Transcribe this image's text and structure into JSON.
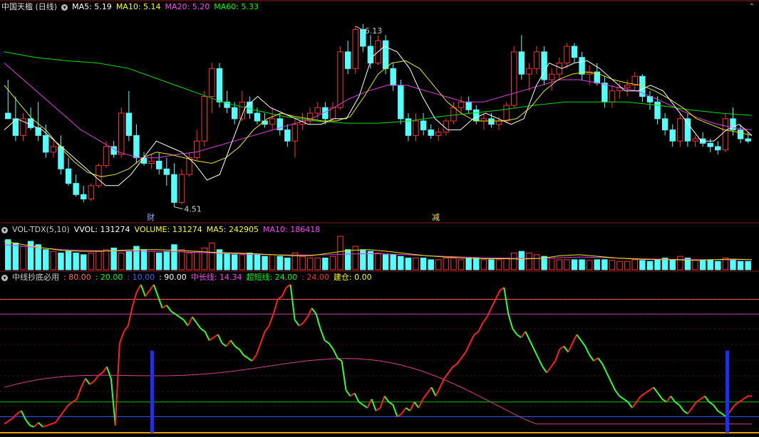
{
  "price_panel": {
    "title": "中国天楹 (日线)",
    "ma_labels": [
      {
        "text": "MA5: 5.19",
        "color": "#ffffff"
      },
      {
        "text": "MA10: 5.14",
        "color": "#ffff00"
      },
      {
        "text": "MA20: 5.20",
        "color": "#ff44ff"
      },
      {
        "text": "MA60: 5.33",
        "color": "#00ff00"
      }
    ],
    "high_label": "6.13",
    "low_label": "4.51",
    "marker_cai": "财",
    "marker_jian": "减",
    "corner_glyph": "⌃"
  },
  "volume_panel": {
    "labels": [
      {
        "text": "VOL-TDX(5,10)",
        "color": "#cccccc"
      },
      {
        "text": "VVOL: 131274",
        "color": "#ffffff"
      },
      {
        "text": "VOLUME: 131274",
        "color": "#ffff00"
      },
      {
        "text": "MA5: 242905",
        "color": "#ffff00"
      },
      {
        "text": "MA10: 186418",
        "color": "#ff44ff"
      }
    ]
  },
  "indicator_panel": {
    "labels": [
      {
        "text": "中线抄底必用",
        "color": "#cccccc"
      },
      {
        "text": ": 80.00",
        "color": "#ff6666"
      },
      {
        "text": ": 20.00",
        "color": "#00ff00"
      },
      {
        "text": ": 10.00",
        "color": "#3366ff"
      },
      {
        "text": ": 90.00",
        "color": "#ffffff"
      },
      {
        "text": "中长线: 14.34",
        "color": "#ff44ff"
      },
      {
        "text": "超短线: 24.00",
        "color": "#00ff00"
      },
      {
        "text": ": 24.00",
        "color": "#ff3333"
      },
      {
        "text": "建仓: 0.00",
        "color": "#ffff00"
      }
    ]
  },
  "chart_data": {
    "type": "candlestick",
    "candles": [
      [
        5.35,
        5.65,
        5.3,
        5.3
      ],
      [
        5.3,
        5.5,
        5.1,
        5.15
      ],
      [
        5.15,
        5.35,
        5.1,
        5.3
      ],
      [
        5.3,
        5.4,
        5.2,
        5.22
      ],
      [
        5.22,
        5.45,
        5.1,
        5.15
      ],
      [
        5.15,
        5.25,
        4.95,
        5.0
      ],
      [
        5.0,
        5.1,
        4.95,
        5.05
      ],
      [
        5.05,
        5.15,
        4.8,
        4.85
      ],
      [
        4.85,
        4.95,
        4.7,
        4.72
      ],
      [
        4.72,
        4.8,
        4.6,
        4.62
      ],
      [
        4.62,
        4.7,
        4.55,
        4.58
      ],
      [
        4.58,
        4.72,
        4.56,
        4.7
      ],
      [
        4.7,
        4.9,
        4.68,
        4.88
      ],
      [
        4.88,
        5.1,
        4.86,
        5.05
      ],
      [
        5.05,
        5.1,
        4.95,
        4.98
      ],
      [
        4.98,
        5.4,
        4.95,
        5.35
      ],
      [
        5.35,
        5.55,
        5.1,
        5.15
      ],
      [
        5.15,
        5.25,
        4.9,
        4.95
      ],
      [
        4.95,
        5.0,
        4.88,
        4.9
      ],
      [
        4.9,
        4.98,
        4.85,
        4.92
      ],
      [
        4.92,
        5.0,
        4.8,
        4.85
      ],
      [
        4.85,
        4.95,
        4.7,
        4.8
      ],
      [
        4.8,
        4.9,
        4.51,
        4.55
      ],
      [
        4.55,
        4.85,
        4.53,
        4.8
      ],
      [
        4.8,
        5.0,
        4.78,
        4.95
      ],
      [
        4.95,
        5.2,
        4.93,
        5.1
      ],
      [
        5.1,
        5.55,
        5.05,
        5.5
      ],
      [
        5.5,
        5.8,
        5.35,
        5.75
      ],
      [
        5.75,
        5.8,
        5.4,
        5.45
      ],
      [
        5.45,
        5.55,
        5.35,
        5.4
      ],
      [
        5.4,
        5.45,
        5.25,
        5.3
      ],
      [
        5.3,
        5.55,
        5.28,
        5.45
      ],
      [
        5.45,
        5.5,
        5.3,
        5.35
      ],
      [
        5.35,
        5.4,
        5.25,
        5.28
      ],
      [
        5.28,
        5.35,
        5.22,
        5.25
      ],
      [
        5.25,
        5.4,
        5.2,
        5.3
      ],
      [
        5.3,
        5.35,
        5.15,
        5.2
      ],
      [
        5.2,
        5.25,
        5.05,
        5.1
      ],
      [
        5.1,
        5.3,
        4.95,
        5.25
      ],
      [
        5.25,
        5.35,
        5.2,
        5.28
      ],
      [
        5.28,
        5.4,
        5.25,
        5.35
      ],
      [
        5.35,
        5.45,
        5.3,
        5.4
      ],
      [
        5.4,
        5.45,
        5.25,
        5.3
      ],
      [
        5.3,
        5.45,
        5.28,
        5.4
      ],
      [
        5.4,
        5.95,
        5.38,
        5.9
      ],
      [
        5.9,
        6.0,
        5.7,
        5.75
      ],
      [
        5.75,
        6.13,
        5.7,
        6.1
      ],
      [
        6.1,
        6.15,
        5.9,
        5.95
      ],
      [
        5.95,
        6.05,
        5.75,
        5.8
      ],
      [
        5.8,
        6.05,
        5.78,
        6.0
      ],
      [
        6.0,
        6.05,
        5.7,
        5.75
      ],
      [
        5.75,
        5.8,
        5.55,
        5.6
      ],
      [
        5.6,
        5.65,
        5.25,
        5.3
      ],
      [
        5.3,
        5.35,
        5.1,
        5.15
      ],
      [
        5.15,
        5.35,
        5.1,
        5.28
      ],
      [
        5.28,
        5.35,
        5.15,
        5.2
      ],
      [
        5.2,
        5.25,
        5.12,
        5.15
      ],
      [
        5.15,
        5.22,
        5.1,
        5.18
      ],
      [
        5.18,
        5.3,
        5.15,
        5.28
      ],
      [
        5.28,
        5.45,
        5.25,
        5.4
      ],
      [
        5.4,
        5.5,
        5.35,
        5.45
      ],
      [
        5.45,
        5.5,
        5.35,
        5.38
      ],
      [
        5.38,
        5.42,
        5.25,
        5.28
      ],
      [
        5.28,
        5.35,
        5.2,
        5.3
      ],
      [
        5.3,
        5.35,
        5.22,
        5.25
      ],
      [
        5.25,
        5.32,
        5.2,
        5.28
      ],
      [
        5.28,
        5.45,
        5.26,
        5.42
      ],
      [
        5.42,
        5.95,
        5.4,
        5.9
      ],
      [
        5.9,
        6.05,
        5.65,
        5.7
      ],
      [
        5.7,
        5.8,
        5.55,
        5.75
      ],
      [
        5.75,
        5.95,
        5.7,
        5.9
      ],
      [
        5.9,
        5.95,
        5.6,
        5.65
      ],
      [
        5.65,
        5.75,
        5.55,
        5.7
      ],
      [
        5.7,
        5.85,
        5.65,
        5.8
      ],
      [
        5.8,
        5.98,
        5.75,
        5.95
      ],
      [
        5.95,
        5.98,
        5.8,
        5.85
      ],
      [
        5.85,
        5.9,
        5.65,
        5.7
      ],
      [
        5.7,
        5.78,
        5.6,
        5.72
      ],
      [
        5.72,
        5.8,
        5.6,
        5.62
      ],
      [
        5.62,
        5.68,
        5.4,
        5.45
      ],
      [
        5.45,
        5.6,
        5.4,
        5.55
      ],
      [
        5.55,
        5.62,
        5.48,
        5.58
      ],
      [
        5.58,
        5.65,
        5.5,
        5.6
      ],
      [
        5.6,
        5.72,
        5.55,
        5.68
      ],
      [
        5.68,
        5.7,
        5.45,
        5.5
      ],
      [
        5.5,
        5.55,
        5.38,
        5.45
      ],
      [
        5.45,
        5.5,
        5.25,
        5.3
      ],
      [
        5.3,
        5.35,
        5.15,
        5.2
      ],
      [
        5.2,
        5.25,
        5.05,
        5.1
      ],
      [
        5.1,
        5.35,
        5.05,
        5.3
      ],
      [
        5.3,
        5.35,
        5.05,
        5.1
      ],
      [
        5.1,
        5.15,
        5.05,
        5.12
      ],
      [
        5.12,
        5.18,
        5.05,
        5.08
      ],
      [
        5.08,
        5.12,
        5.0,
        5.05
      ],
      [
        5.05,
        5.1,
        4.98,
        5.02
      ],
      [
        5.02,
        5.35,
        5.0,
        5.3
      ],
      [
        5.3,
        5.4,
        5.15,
        5.2
      ],
      [
        5.2,
        5.25,
        5.08,
        5.12
      ],
      [
        5.12,
        5.18,
        5.08,
        5.1
      ]
    ],
    "ma5": [
      5.2,
      5.3,
      5.25,
      5.2,
      5.1,
      5.0,
      4.9,
      4.8,
      4.7,
      4.7,
      4.8,
      4.95,
      5.1,
      5.05,
      5.0,
      4.9,
      4.75,
      4.8,
      5.1,
      5.4,
      5.5,
      5.4,
      5.35,
      5.3,
      5.25,
      5.25,
      5.3,
      5.3,
      5.5,
      5.85,
      5.95,
      5.9,
      5.75,
      5.5,
      5.3,
      5.2,
      5.2,
      5.3,
      5.35,
      5.3,
      5.25,
      5.3,
      5.6,
      5.8,
      5.75,
      5.8,
      5.82,
      5.75,
      5.65,
      5.55,
      5.55,
      5.6,
      5.55,
      5.4,
      5.25,
      5.1,
      5.1,
      5.2,
      5.25,
      5.15
    ],
    "ma10": [
      5.6,
      5.45,
      5.3,
      5.2,
      5.05,
      4.92,
      4.82,
      4.78,
      4.8,
      4.85,
      4.95,
      5.0,
      4.98,
      4.95,
      4.92,
      4.9,
      4.95,
      5.05,
      5.2,
      5.3,
      5.35,
      5.32,
      5.3,
      5.28,
      5.28,
      5.32,
      5.5,
      5.7,
      5.8,
      5.82,
      5.75,
      5.6,
      5.45,
      5.35,
      5.28,
      5.28,
      5.28,
      5.3,
      5.4,
      5.55,
      5.65,
      5.7,
      5.72,
      5.7,
      5.65,
      5.62,
      5.6,
      5.55,
      5.48,
      5.4,
      5.3,
      5.25,
      5.2,
      5.18,
      5.15
    ],
    "ma20": [
      5.8,
      5.65,
      5.5,
      5.35,
      5.2,
      5.1,
      5.0,
      4.95,
      4.95,
      4.98,
      5.0,
      5.05,
      5.1,
      5.15,
      5.2,
      5.25,
      5.3,
      5.38,
      5.48,
      5.55,
      5.6,
      5.6,
      5.55,
      5.5,
      5.45,
      5.45,
      5.5,
      5.55,
      5.6,
      5.65,
      5.65,
      5.62,
      5.58,
      5.55,
      5.48,
      5.4,
      5.32,
      5.26,
      5.22,
      5.2
    ],
    "ma60": [
      5.9,
      5.85,
      5.82,
      5.8,
      5.75,
      5.65,
      5.55,
      5.45,
      5.38,
      5.32,
      5.28,
      5.26,
      5.26,
      5.28,
      5.32,
      5.35,
      5.38,
      5.42,
      5.45,
      5.45,
      5.45,
      5.42,
      5.38,
      5.35,
      5.33
    ],
    "volume": [
      0.9,
      0.8,
      0.7,
      0.85,
      0.75,
      0.6,
      0.55,
      0.5,
      0.55,
      0.5,
      0.45,
      0.5,
      0.55,
      0.6,
      0.65,
      0.5,
      0.55,
      0.7,
      0.6,
      0.55,
      0.5,
      0.55,
      0.75,
      0.6,
      0.5,
      0.55,
      0.65,
      0.8,
      0.6,
      0.5,
      0.45,
      0.45,
      0.5,
      0.45,
      0.4,
      0.45,
      0.4,
      0.35,
      0.5,
      0.4,
      0.35,
      0.35,
      0.35,
      0.4,
      1.0,
      0.6,
      0.7,
      0.6,
      0.55,
      0.5,
      0.45,
      0.45,
      0.4,
      0.35,
      0.35,
      0.35,
      0.3,
      0.3,
      0.35,
      0.35,
      0.3,
      0.35,
      0.35,
      0.3,
      0.3,
      0.3,
      0.35,
      0.5,
      0.55,
      0.5,
      0.45,
      0.4,
      0.35,
      0.3,
      0.3,
      0.3,
      0.3,
      0.28,
      0.3,
      0.3,
      0.28,
      0.25,
      0.25,
      0.3,
      0.28,
      0.25,
      0.3,
      0.35,
      0.3,
      0.4,
      0.35,
      0.3,
      0.28,
      0.3,
      0.25,
      0.35,
      0.3,
      0.25,
      0.25
    ],
    "vol_ma": [
      0.85,
      0.75,
      0.65,
      0.58,
      0.55,
      0.55,
      0.58,
      0.6,
      0.6,
      0.58,
      0.55,
      0.52,
      0.5,
      0.48,
      0.45,
      0.42,
      0.42,
      0.5,
      0.58,
      0.6,
      0.55,
      0.48,
      0.42,
      0.38,
      0.35,
      0.33,
      0.33,
      0.32,
      0.34,
      0.42,
      0.45,
      0.4,
      0.35,
      0.32,
      0.3,
      0.3,
      0.28,
      0.3,
      0.32,
      0.3
    ],
    "vol_ma10": [
      0.75,
      0.7,
      0.65,
      0.6,
      0.58,
      0.57,
      0.56,
      0.56,
      0.55,
      0.54,
      0.52,
      0.5,
      0.48,
      0.46,
      0.45,
      0.44,
      0.44,
      0.45,
      0.47,
      0.48,
      0.47,
      0.45,
      0.42,
      0.4,
      0.38,
      0.36,
      0.35,
      0.34,
      0.34,
      0.36,
      0.38,
      0.37,
      0.35,
      0.33,
      0.32,
      0.31,
      0.3,
      0.3,
      0.3,
      0.3
    ],
    "short_line": [
      5,
      7,
      9,
      12,
      14,
      8,
      4,
      3,
      6,
      3,
      4,
      5,
      6,
      10,
      14,
      18,
      20,
      22,
      30,
      36,
      32,
      34,
      38,
      40,
      44,
      36,
      4,
      60,
      68,
      72,
      85,
      95,
      100,
      92,
      96,
      100,
      92,
      84,
      86,
      82,
      80,
      78,
      76,
      72,
      78,
      74,
      70,
      68,
      62,
      64,
      66,
      60,
      58,
      62,
      58,
      56,
      52,
      50,
      48,
      52,
      60,
      68,
      72,
      80,
      90,
      92,
      98,
      100,
      76,
      72,
      74,
      78,
      84,
      80,
      70,
      62,
      60,
      56,
      50,
      48,
      28,
      24,
      26,
      20,
      18,
      16,
      22,
      14,
      16,
      24,
      20,
      18,
      10,
      12,
      16,
      14,
      20,
      16,
      22,
      26,
      30,
      24,
      30,
      36,
      40,
      44,
      46,
      50,
      54,
      60,
      66,
      68,
      74,
      78,
      84,
      90,
      96,
      98,
      80,
      70,
      66,
      64,
      68,
      62,
      56,
      50,
      44,
      40,
      44,
      48,
      56,
      58,
      54,
      60,
      66,
      62,
      58,
      52,
      48,
      50,
      46,
      40,
      34,
      28,
      24,
      22,
      20,
      16,
      20,
      24,
      26,
      28,
      30,
      26,
      22,
      20,
      24,
      20,
      18,
      14,
      12,
      16,
      20,
      22,
      24,
      20,
      18,
      14,
      12,
      10,
      14,
      18,
      20,
      22,
      24,
      24
    ]
  }
}
